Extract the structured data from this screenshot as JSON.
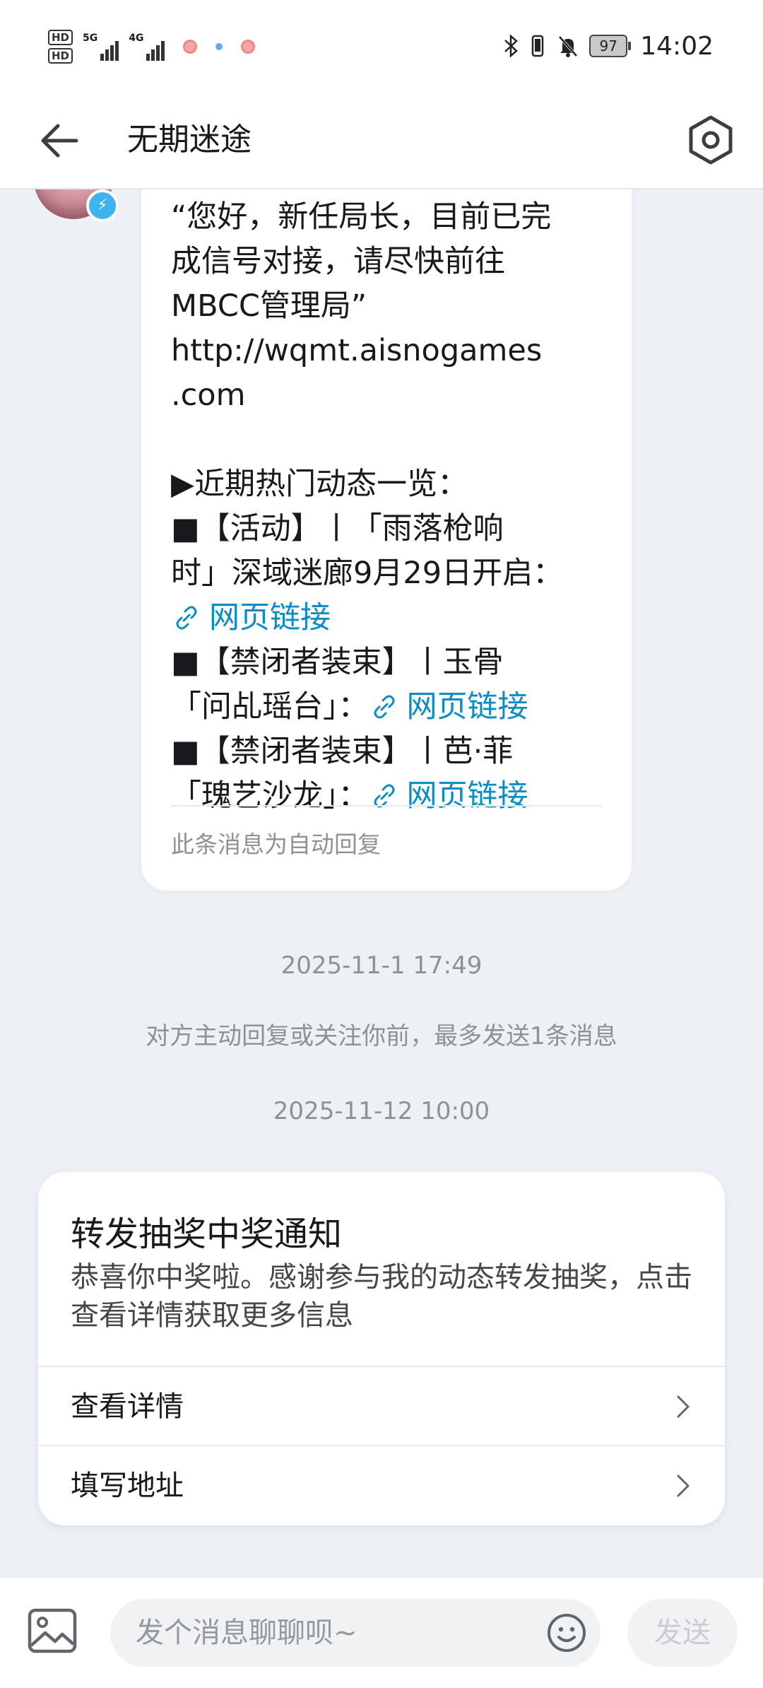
{
  "status_bar": {
    "hd1": "HD",
    "hd2": "HD",
    "net1": "5G",
    "net2": "4G",
    "battery": "97",
    "time": "14:02",
    "icons": [
      "bluetooth-icon",
      "vibrate-icon",
      "mute-icon"
    ]
  },
  "header": {
    "title": "无期迷途",
    "back_icon": "arrow-left-icon",
    "settings_icon": "hexagon-settings-icon"
  },
  "message": {
    "lines": [
      "“您好，新任局长，目前已完",
      "成信号对接，请尽快前往",
      "MBCC管理局”",
      "http://wqmt.aisnogames",
      ".com",
      "",
      "▶近期热门动态一览：",
      "■【活动】丨「雨落枪响",
      "时」深域迷廊9月29日开启："
    ],
    "link_text": "网页链接",
    "item2_line1": "■【禁闭者装束】丨玉骨",
    "item2_line2": "「问乩瑶台」：",
    "item3_line1": "■【禁闭者装束】丨芭·菲",
    "item3_line2": "「瑰艺沙龙」：",
    "auto_reply": "此条消息为自动回复"
  },
  "timestamp1": "2025-11-1 17:49",
  "notice": "对方主动回复或关注你前，最多发送1条消息",
  "timestamp2": "2025-11-12 10:00",
  "card": {
    "title": "转发抽奖中奖通知",
    "description": "恭喜你中奖啦。感谢参与我的动态转发抽奖，点击查看详情获取更多信息",
    "actions": [
      {
        "label": "查看详情"
      },
      {
        "label": "填写地址"
      }
    ]
  },
  "input_bar": {
    "placeholder": "发个消息聊聊呗~",
    "send_label": "发送"
  },
  "colors": {
    "link": "#0a8cc8",
    "background": "#edf0f4",
    "verified": "#3fb3ee"
  }
}
